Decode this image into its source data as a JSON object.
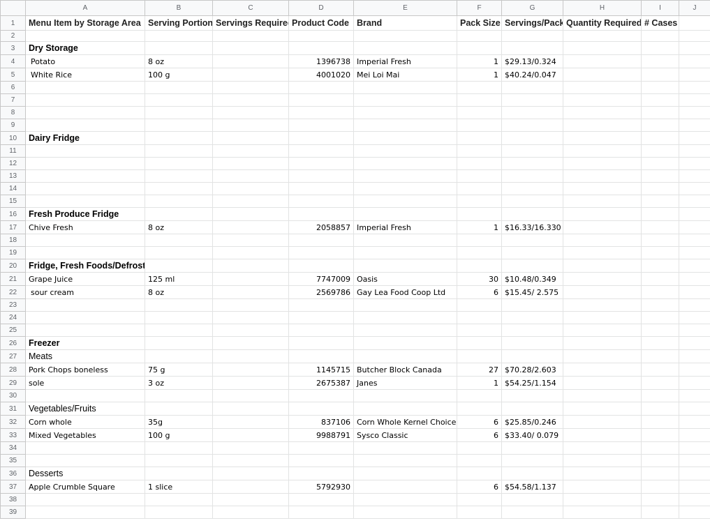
{
  "sheet": {
    "columns": [
      "A",
      "B",
      "C",
      "D",
      "E",
      "F",
      "G",
      "H",
      "I",
      "J"
    ],
    "headers": {
      "a": "Menu Item by Storage Area",
      "b": "Serving Portion",
      "c": "Servings Required",
      "d": "Product Code",
      "e": "Brand",
      "f": "Pack Size",
      "g": "Servings/Pack",
      "h": "Quantity Required",
      "i": "# Cases to Order"
    },
    "rows": [
      {
        "n": "1",
        "kind": "header"
      },
      {
        "n": "2"
      },
      {
        "n": "3",
        "kind": "section",
        "a": "Dry Storage"
      },
      {
        "n": "4",
        "kind": "item",
        "indent": true,
        "a": "Potato",
        "b": "8 oz",
        "d": "1396738",
        "e": "Imperial Fresh",
        "f": "1",
        "g": "$29.13/0.324"
      },
      {
        "n": "5",
        "kind": "item",
        "indent": true,
        "a": "White Rice",
        "b": "100 g",
        "d": "4001020",
        "e": "Mei Loi Mai",
        "f": "1",
        "g": "$40.24/0.047"
      },
      {
        "n": "6"
      },
      {
        "n": "7"
      },
      {
        "n": "8"
      },
      {
        "n": "9"
      },
      {
        "n": "10",
        "kind": "section",
        "a": "Dairy Fridge"
      },
      {
        "n": "11"
      },
      {
        "n": "12"
      },
      {
        "n": "13"
      },
      {
        "n": "14"
      },
      {
        "n": "15"
      },
      {
        "n": "16",
        "kind": "section",
        "a": "Fresh Produce Fridge"
      },
      {
        "n": "17",
        "kind": "item",
        "a": "Chive Fresh",
        "b": "8 oz",
        "d": "2058857",
        "e": "Imperial Fresh",
        "f": "1",
        "g": "$16.33/16.330"
      },
      {
        "n": "18"
      },
      {
        "n": "19"
      },
      {
        "n": "20",
        "kind": "section",
        "a": "Fridge, Fresh Foods/Defrost"
      },
      {
        "n": "21",
        "kind": "item",
        "a": "Grape Juice",
        "b": "125 ml",
        "d": "7747009",
        "e": "Oasis",
        "f": "30",
        "g": "$10.48/0.349"
      },
      {
        "n": "22",
        "kind": "item",
        "indent": true,
        "a": "sour cream",
        "b": "8 oz",
        "d": "2569786",
        "e": "Gay Lea Food Coop Ltd",
        "f": "6",
        "g": " $15.45/ 2.575"
      },
      {
        "n": "23"
      },
      {
        "n": "24"
      },
      {
        "n": "25"
      },
      {
        "n": "26",
        "kind": "section",
        "a": "Freezer"
      },
      {
        "n": "27",
        "kind": "subsection",
        "a": "Meats"
      },
      {
        "n": "28",
        "kind": "item",
        "a": "Pork Chops boneless",
        "b": "75 g",
        "d": "1145715",
        "e": "Butcher Block Canada",
        "f": "27",
        "g": "$70.28/2.603"
      },
      {
        "n": "29",
        "kind": "item",
        "a": "sole",
        "b": "3 oz",
        "d": "2675387",
        "e": "Janes",
        "f": "1",
        "g": " $54.25/1.154"
      },
      {
        "n": "30"
      },
      {
        "n": "31",
        "kind": "subsection",
        "a": "Vegetables/Fruits"
      },
      {
        "n": "32",
        "kind": "item",
        "a": "Corn whole",
        "b": "35g",
        "d": "837106",
        "e": "Corn Whole Kernel Choice",
        "f": "6",
        "g": " $25.85/0.246"
      },
      {
        "n": "33",
        "kind": "item",
        "a": "Mixed Vegetables",
        "b": "100 g",
        "d": "9988791",
        "e": "Sysco Classic",
        "f": "6",
        "g": " $33.40/ 0.079"
      },
      {
        "n": "34"
      },
      {
        "n": "35"
      },
      {
        "n": "36",
        "kind": "subsection",
        "a": "Desserts"
      },
      {
        "n": "37",
        "kind": "item",
        "a": "Apple Crumble Square",
        "b": "1 slice",
        "d": "5792930",
        "f": "6",
        "g": "$54.58/1.137"
      },
      {
        "n": "38"
      },
      {
        "n": "39"
      }
    ]
  }
}
